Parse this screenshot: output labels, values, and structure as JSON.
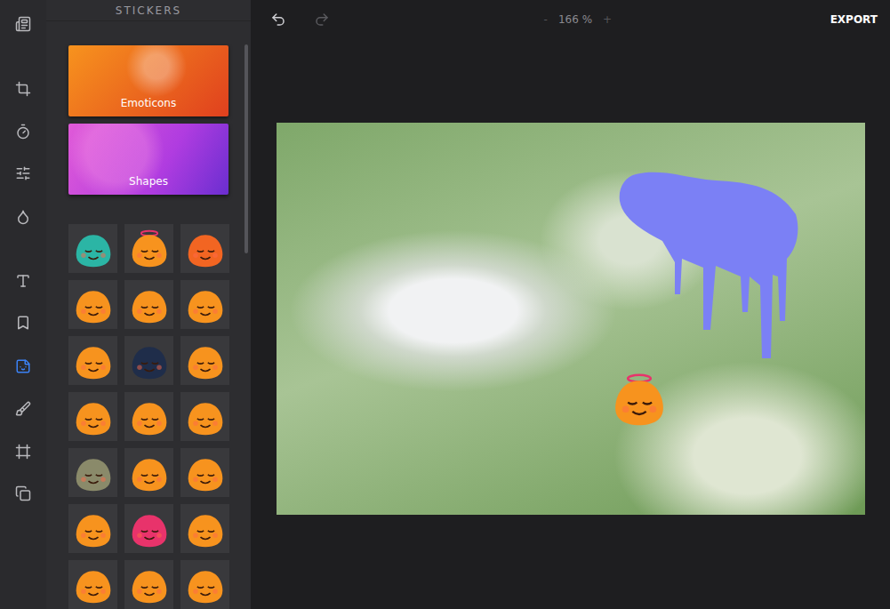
{
  "rail": {
    "items": [
      {
        "selected": false
      },
      {
        "selected": false
      },
      {
        "selected": false
      },
      {
        "selected": false
      },
      {
        "selected": false
      },
      {
        "selected": false
      },
      {
        "selected": false
      },
      {
        "selected": true
      },
      {
        "selected": false
      },
      {
        "selected": false
      },
      {
        "selected": false
      }
    ]
  },
  "panel": {
    "title": "STICKERS",
    "categories": [
      {
        "label": "Emoticons",
        "color": "#f7931e"
      },
      {
        "label": "Shapes",
        "color": "#b03ce0"
      }
    ],
    "stickers": [
      {
        "color": "#2bb5a5"
      },
      {
        "color": "#f7931e"
      },
      {
        "color": "#f26522"
      },
      {
        "color": "#f7931e"
      },
      {
        "color": "#f7931e"
      },
      {
        "color": "#f7931e"
      },
      {
        "color": "#f7931e"
      },
      {
        "color": "#1f2d4a"
      },
      {
        "color": "#f7931e"
      },
      {
        "color": "#f7931e"
      },
      {
        "color": "#f7931e"
      },
      {
        "color": "#f7931e"
      },
      {
        "color": "#8a8a6a"
      },
      {
        "color": "#f7931e"
      },
      {
        "color": "#f7931e"
      },
      {
        "color": "#f7931e"
      },
      {
        "color": "#e8336b"
      },
      {
        "color": "#f7931e"
      },
      {
        "color": "#f7931e"
      },
      {
        "color": "#f7931e"
      },
      {
        "color": "#f7931e"
      }
    ]
  },
  "toolbar": {
    "undo": {
      "disabled": false
    },
    "redo": {
      "disabled": true
    },
    "zoom_out": "-",
    "zoom": "166 %",
    "zoom_in": "+",
    "export": "EXPORT"
  },
  "canvas": {
    "placed": [
      {
        "kind": "drip",
        "color": "#7b80f5"
      },
      {
        "kind": "emoticon",
        "color": "#f7931e"
      }
    ]
  }
}
